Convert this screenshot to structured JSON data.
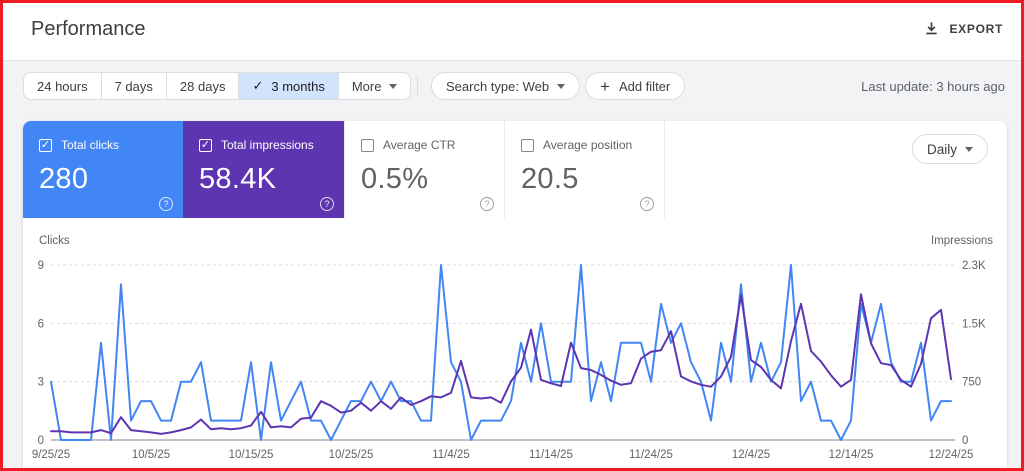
{
  "header": {
    "title": "Performance",
    "export_label": "EXPORT"
  },
  "filters": {
    "date_ranges": [
      "24 hours",
      "7 days",
      "28 days",
      "3 months"
    ],
    "selected_range": "3 months",
    "more_label": "More",
    "search_type_label": "Search type: Web",
    "add_filter_label": "Add filter",
    "last_update": "Last update: 3 hours ago"
  },
  "glyphs": {
    "check": "✓",
    "plus": "+",
    "question": "?"
  },
  "metrics": {
    "granularity": "Daily",
    "cards": [
      {
        "label": "Total clicks",
        "value": "280",
        "checked": true,
        "color": "#4285f4"
      },
      {
        "label": "Total impressions",
        "value": "58.4K",
        "checked": true,
        "color": "#5e35b1"
      },
      {
        "label": "Average CTR",
        "value": "0.5%",
        "checked": false
      },
      {
        "label": "Average position",
        "value": "20.5",
        "checked": false
      }
    ]
  },
  "chart_data": {
    "type": "line",
    "title": "Clicks and impressions over time (Daily)",
    "x_start_date": "9/25/25",
    "x_end_date": "12/24/25",
    "x_tick_labels": [
      "9/25/25",
      "10/5/25",
      "10/15/25",
      "10/25/25",
      "11/4/25",
      "11/14/25",
      "11/24/25",
      "12/4/25",
      "12/14/25",
      "12/24/25"
    ],
    "grid": "horizontal-dashed",
    "legend_position": "none",
    "left_axis": {
      "label": "Clicks",
      "max": 9,
      "ticks": [
        0,
        3,
        6,
        9
      ],
      "tick_labels": [
        "0",
        "3",
        "6",
        "9"
      ]
    },
    "right_axis": {
      "label": "Impressions",
      "max": 2300,
      "ticks": [
        0,
        750,
        1500,
        2300
      ],
      "tick_labels": [
        "0",
        "750",
        "1.5K",
        "2.3K"
      ]
    },
    "series": [
      {
        "name": "Clicks",
        "axis": "left",
        "color": "#4285f4",
        "values": [
          3,
          0,
          0,
          0,
          0,
          5,
          0,
          8,
          1,
          2,
          2,
          1,
          1,
          3,
          3,
          4,
          1,
          1,
          1,
          1,
          4,
          0,
          4,
          1,
          2,
          3,
          1,
          1,
          0,
          1,
          2,
          2,
          3,
          2,
          3,
          2,
          2,
          1,
          1,
          9,
          4,
          3,
          0,
          1,
          1,
          1,
          2,
          5,
          3,
          6,
          3,
          3,
          3,
          9,
          2,
          4,
          2,
          5,
          5,
          5,
          3,
          7,
          5,
          6,
          4,
          3,
          1,
          5,
          3,
          8,
          3,
          5,
          3,
          4,
          9,
          2,
          3,
          1,
          1,
          0,
          1,
          7,
          5,
          7,
          4,
          3,
          3,
          5,
          1,
          2,
          2
        ]
      },
      {
        "name": "Impressions",
        "axis": "right",
        "color": "#5e35b1",
        "values": [
          115,
          115,
          100,
          100,
          100,
          130,
          90,
          300,
          130,
          115,
          100,
          80,
          100,
          130,
          165,
          270,
          140,
          155,
          140,
          155,
          190,
          370,
          165,
          180,
          165,
          280,
          295,
          510,
          450,
          360,
          385,
          490,
          385,
          510,
          410,
          560,
          460,
          510,
          575,
          560,
          620,
          1040,
          560,
          545,
          560,
          490,
          770,
          950,
          1450,
          790,
          745,
          710,
          1280,
          945,
          920,
          855,
          780,
          725,
          745,
          1070,
          1160,
          1180,
          1430,
          835,
          770,
          725,
          700,
          835,
          1095,
          1900,
          1050,
          960,
          790,
          680,
          1300,
          1790,
          1170,
          1030,
          850,
          700,
          790,
          1915,
          1270,
          1010,
          985,
          790,
          700,
          1000,
          1600,
          1710,
          800
        ]
      }
    ],
    "totals": {
      "total_clicks": "280",
      "total_impressions": "58.4K",
      "average_ctr": "0.5%",
      "average_position": "20.5"
    }
  }
}
